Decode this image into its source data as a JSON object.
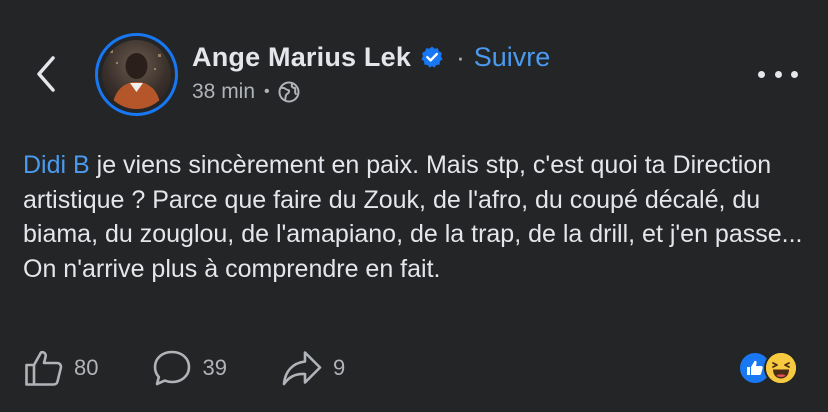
{
  "header": {
    "author_name": "Ange Marius Lek",
    "separator": "·",
    "follow_label": "Suivre",
    "timestamp": "38 min",
    "meta_separator": "•",
    "verified_icon": "verified-badge-icon",
    "privacy_icon": "globe-icon"
  },
  "post": {
    "mention": "Didi B",
    "text": " je viens sincèrement en paix. Mais stp, c'est quoi ta Direction artistique ? Parce que faire du Zouk, de l'afro, du coupé décalé, du biama, du zouglou, de l'amapiano, de la trap, de la drill, et j'en passe... On n'arrive plus à comprendre en fait."
  },
  "actions": {
    "likes": "80",
    "comments": "39",
    "shares": "9"
  },
  "reactions": [
    "like-reaction-icon",
    "haha-reaction-icon"
  ],
  "colors": {
    "background": "#242526",
    "accent": "#1877f2",
    "link": "#4a9af0",
    "text": "#e4e6eb",
    "secondary": "#b0b3b8"
  }
}
